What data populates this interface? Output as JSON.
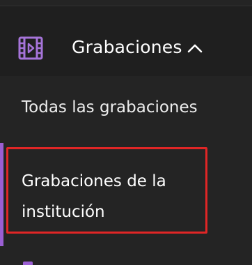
{
  "nav": {
    "section": {
      "icon": "film-icon",
      "label": "Grabaciones",
      "expanded": true,
      "chevron": "chevron-up-icon"
    },
    "items": [
      {
        "label": "Todas las grabaciones",
        "active": false
      },
      {
        "label": "Grabaciones de la institución",
        "active": true
      }
    ]
  },
  "colors": {
    "accent": "#9b5fd3",
    "highlight": "#e02626",
    "background": "#1b1b1b",
    "submenu_background": "#242424"
  }
}
